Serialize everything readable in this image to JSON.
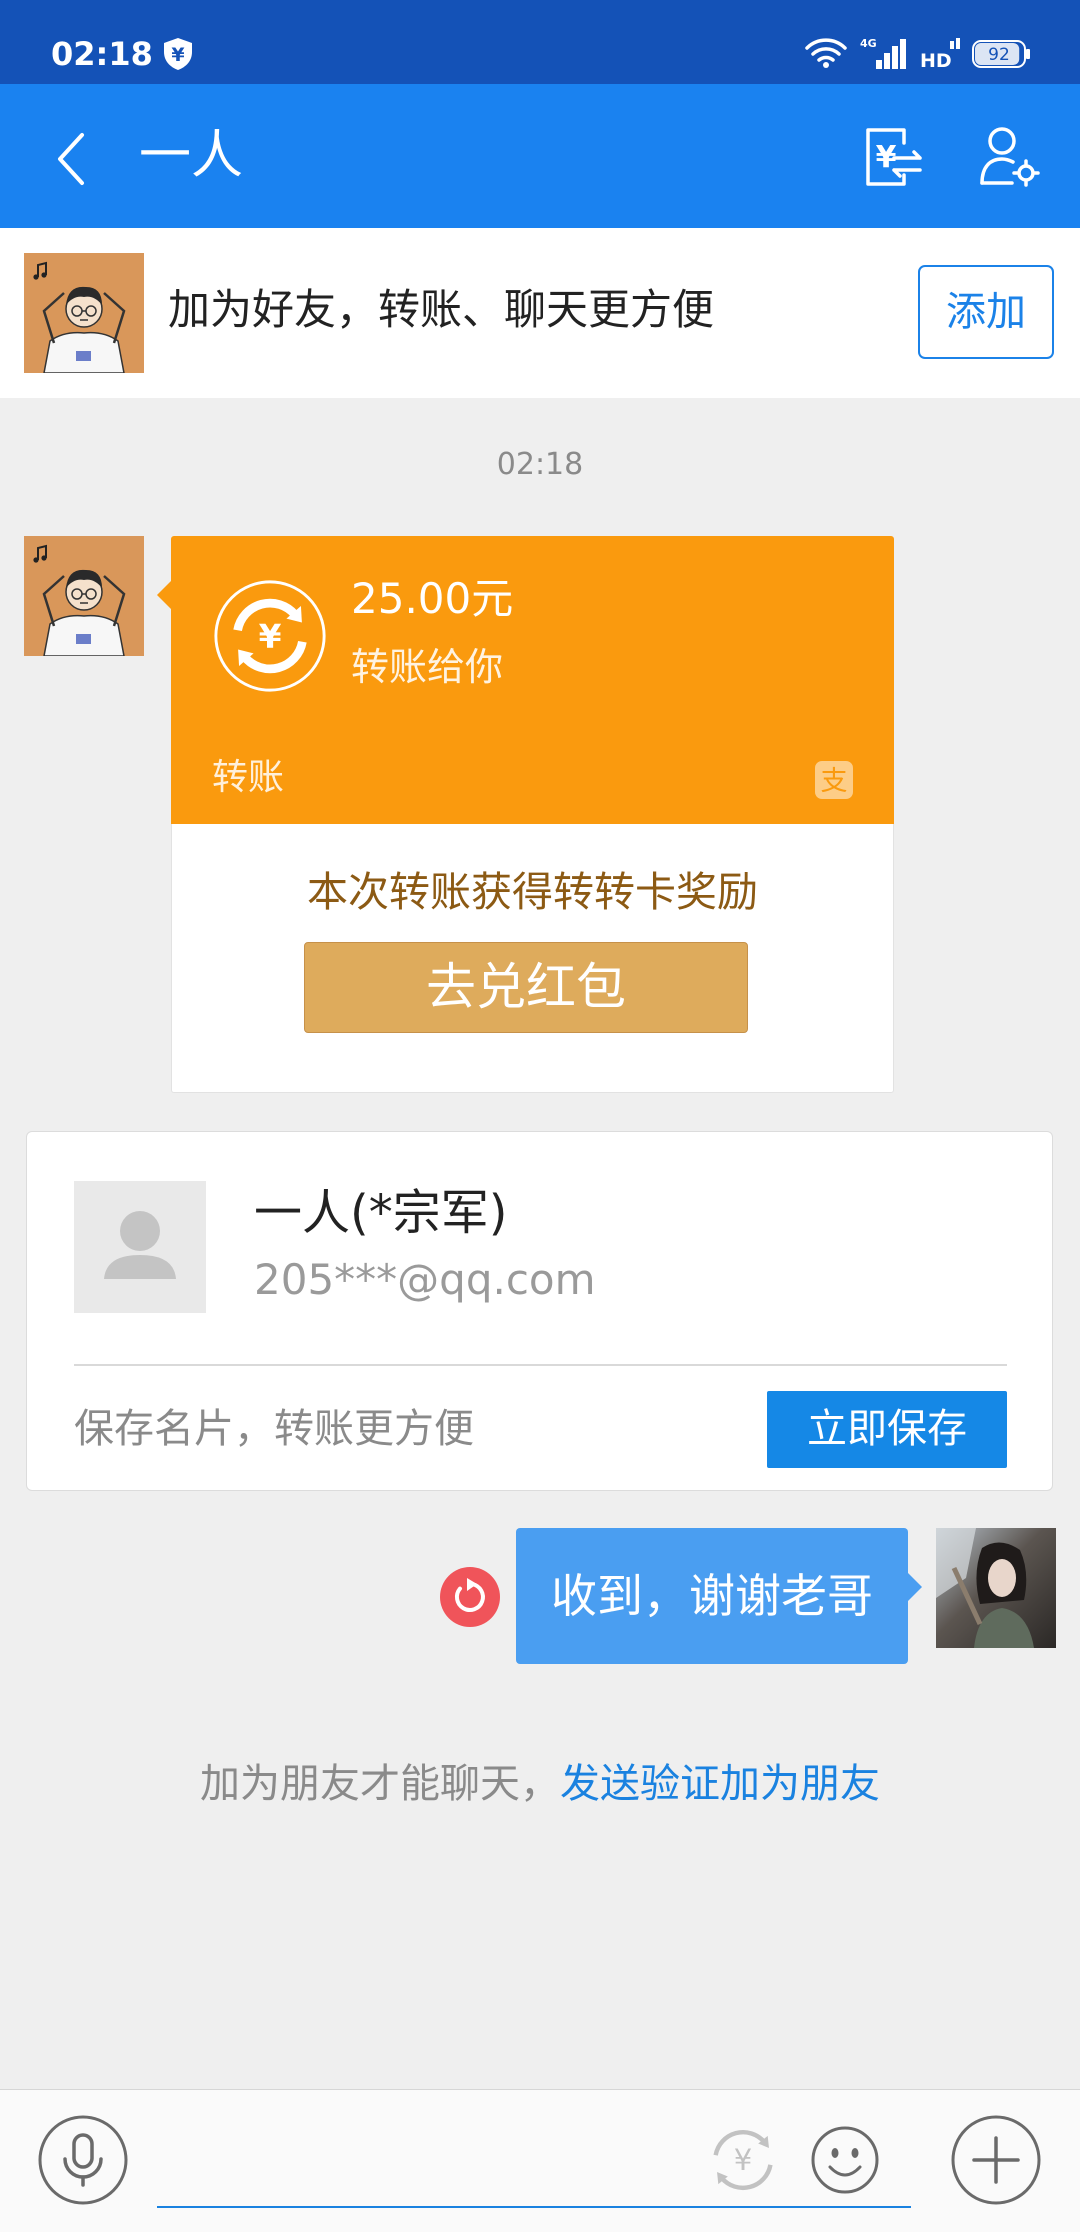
{
  "status_bar": {
    "time": "02:18",
    "network": "4G",
    "hd_label": "HD",
    "battery": "92"
  },
  "nav": {
    "title": "一人"
  },
  "add_friend_banner": {
    "text": "加为好友，转账、聊天更方便",
    "button": "添加"
  },
  "chat": {
    "timestamp": "02:18",
    "transfer": {
      "amount": "25.00元",
      "caption": "转账给你",
      "label": "转账",
      "reward_text": "本次转账获得转转卡奖励",
      "reward_button": "去兑红包"
    },
    "contact_card": {
      "name": "一人(*宗军)",
      "email": "205***@qq.com",
      "hint": "保存名片，转账更方便",
      "save_button": "立即保存"
    },
    "my_message": {
      "text": "收到，谢谢老哥"
    },
    "notice": {
      "text": "加为朋友才能聊天，",
      "link": "发送验证加为朋友"
    }
  },
  "icons": {
    "yen_glyph": "¥",
    "alipay_glyph": "支",
    "status_shield": "shield-yen-icon",
    "wifi": "wifi-icon",
    "signal": "signal-icon",
    "battery": "battery-icon",
    "back": "chevron-left-icon",
    "transfer": "transfer-icon",
    "profile_settings": "profile-settings-icon",
    "transfer_card": "transfer-circle-icon",
    "alipay": "alipay-logo-icon",
    "resend": "resend-icon",
    "mic": "microphone-icon",
    "quick_transfer": "transfer-circle-icon",
    "emoji": "emoji-icon",
    "plus": "plus-icon"
  },
  "colors": {
    "status_bar": "#1452b7",
    "nav_bar": "#1a82f0",
    "chat_bg": "#efefef",
    "accent": "#1b82e8",
    "transfer_orange": "#fa9a0e",
    "reward_text": "#8c5a14",
    "reward_button": "#deab5c",
    "save_button": "#1588e6",
    "bubble": "#4a9ef1",
    "link": "#1a82e0",
    "resend_red": "#f0545a"
  }
}
